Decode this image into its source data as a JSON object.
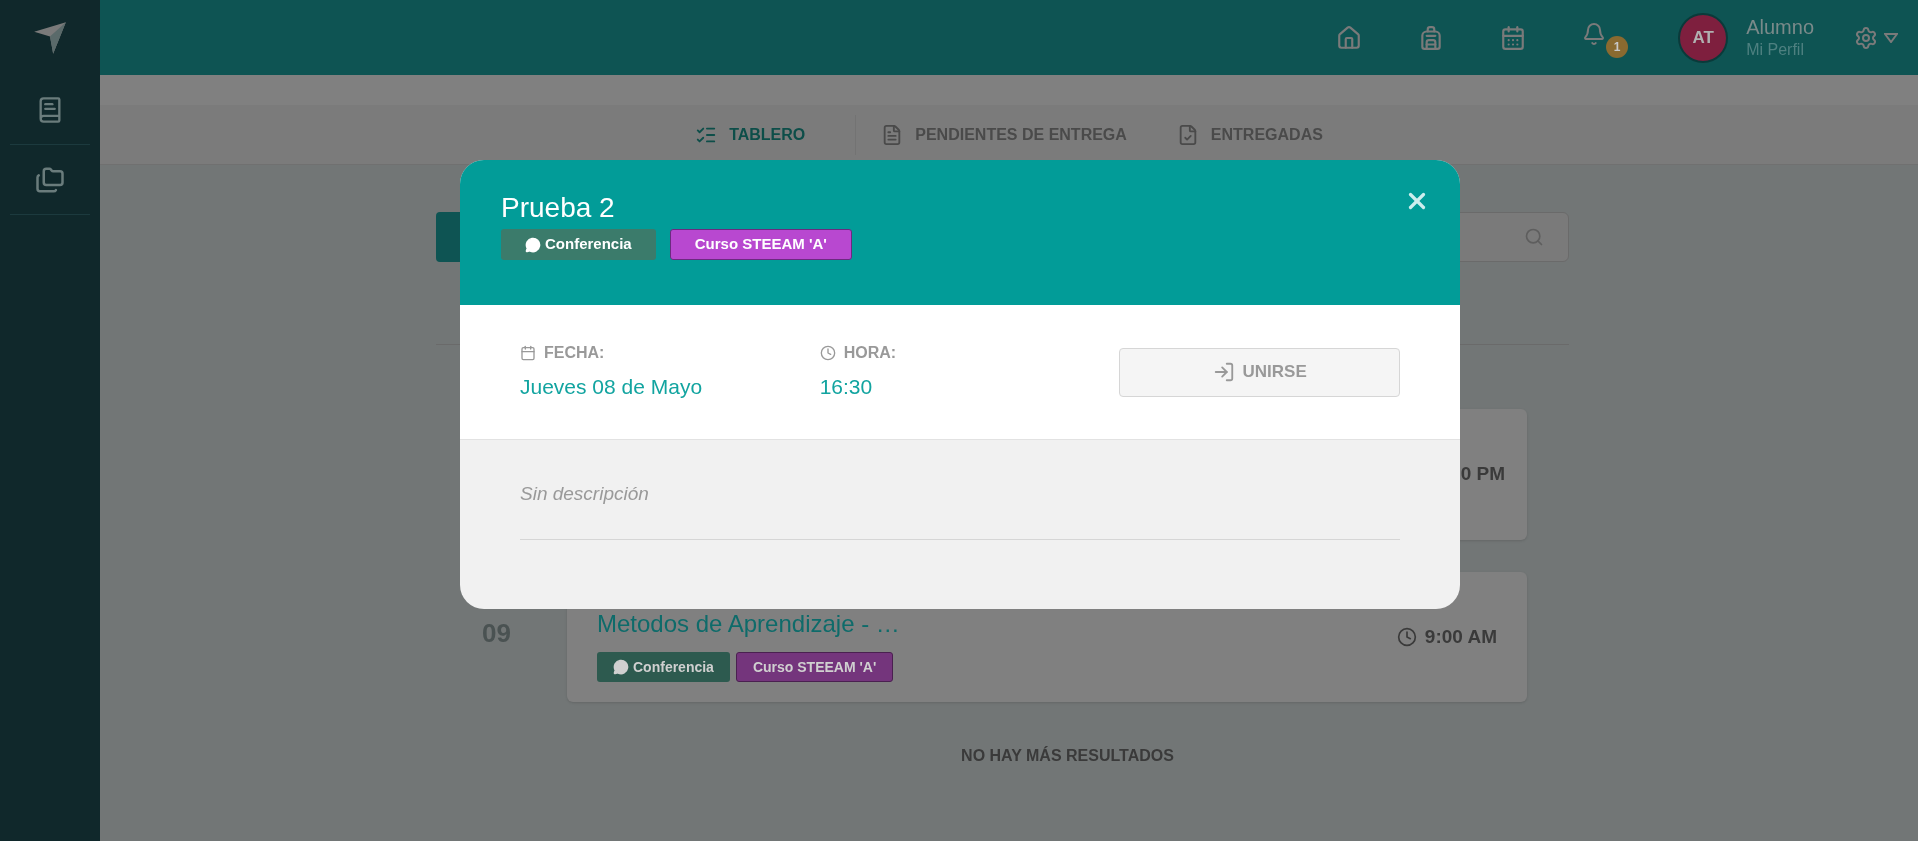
{
  "topbar": {
    "notification_count": "1",
    "avatar_initials": "AT",
    "user_name": "Alumno",
    "user_link": "Mi Perfil"
  },
  "tabs": [
    {
      "label": "TABLERO",
      "selected": true,
      "kind": "board"
    },
    {
      "label": "PENDIENTES DE ENTREGA",
      "selected": false,
      "kind": "pending"
    },
    {
      "label": "ENTREGADAS",
      "selected": false,
      "kind": "delivered"
    }
  ],
  "events": [
    {
      "time": "0 PM"
    },
    {
      "day": "09",
      "title": "Metodos de Aprendizaje - …",
      "time": "9:00 AM",
      "tags": [
        {
          "label": "Conferencia",
          "kind": "type",
          "color": "#2d5a4f"
        },
        {
          "label": "Curso STEEAM 'A'",
          "kind": "course",
          "color": "#74357c"
        }
      ]
    }
  ],
  "footer_note": "NO HAY MÁS RESULTADOS",
  "modal": {
    "title": "Prueba 2",
    "tags": [
      {
        "label": "Conferencia",
        "kind": "type",
        "color": "#3b7b6b"
      },
      {
        "label": "Curso STEEAM 'A'",
        "kind": "course",
        "color": "#b848d0"
      }
    ],
    "date_label": "FECHA:",
    "date": "Jueves 08 de Mayo",
    "time_label": "HORA:",
    "time": "16:30",
    "join_button": "UNIRSE",
    "description": "Sin descripción"
  }
}
